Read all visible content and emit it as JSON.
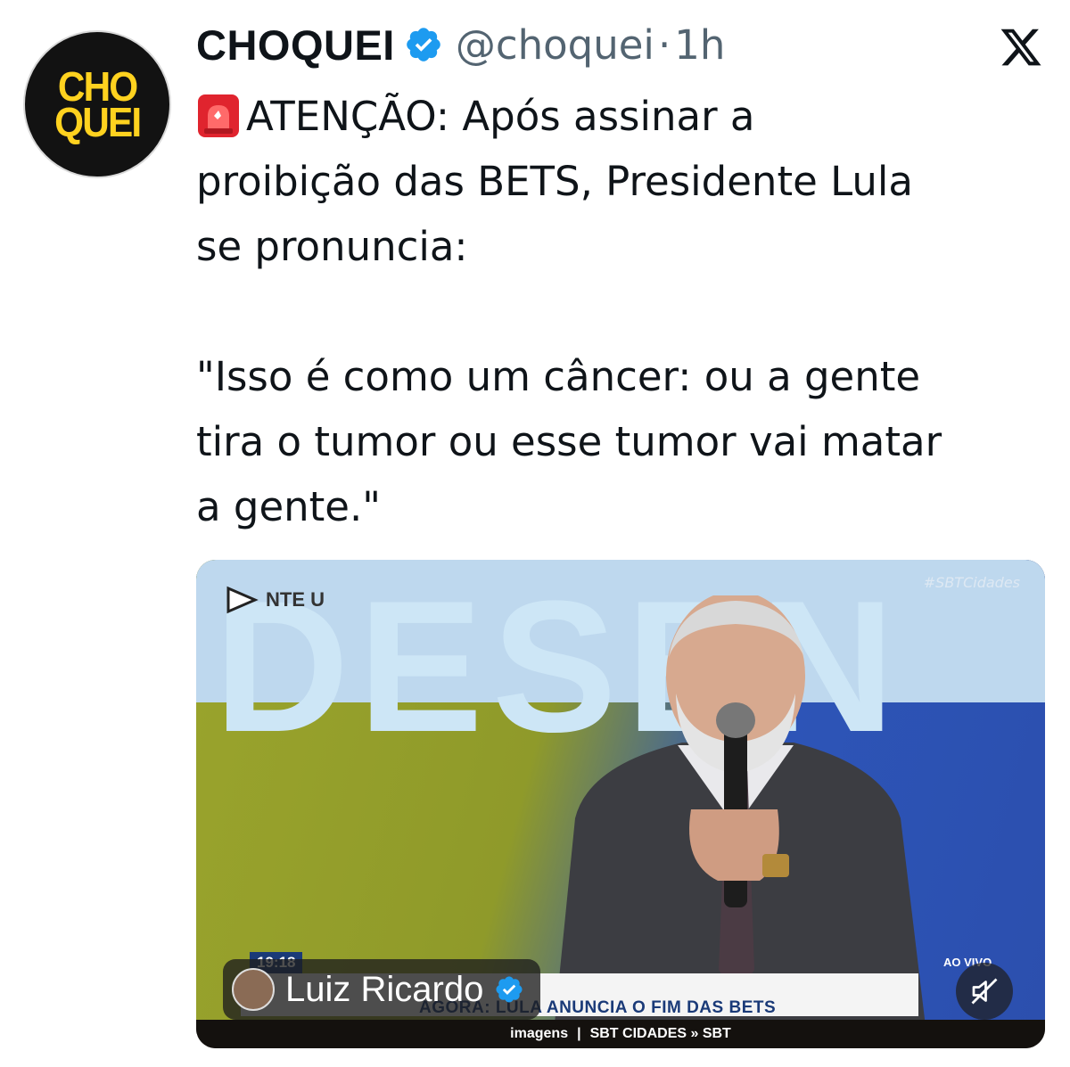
{
  "author": {
    "display_name": "CHOQUEI",
    "handle": "@choquei",
    "separator": "·",
    "time": "1h",
    "avatar_logo_lines": [
      "CHO",
      "QUEI"
    ]
  },
  "icons": {
    "verified": "verified-badge-icon",
    "platform": "x-logo-icon",
    "siren": "siren-emoji-icon",
    "mute": "muted-speaker-icon"
  },
  "tweet": {
    "line1": "ATENÇÃO: Após assinar a",
    "line2": "proibição das BETS, Presidente Lula",
    "line3": "se pronuncia:",
    "quote1": "\"Isso é como um câncer: ou a gente",
    "quote2": "tira o tumor ou esse tumor vai matar",
    "quote3": "a gente.\""
  },
  "media": {
    "background_word": "DESEN",
    "channel_logo_text": "NTE U",
    "hashtag": "#SBTCidades",
    "clock": "19:18",
    "ao_vivo": "AO VIVO",
    "ticker": "AGORA: LULA ANUNCIA O FIM DAS BETS",
    "credit_left": "imagens",
    "credit_sep": "|",
    "credit_right": "SBT CIDADES » SBT",
    "tagged_user": "Luiz Ricardo"
  },
  "colors": {
    "verified_blue": "#1d9bf0",
    "text": "#0f1419",
    "muted": "#536471",
    "logo_yellow": "#ffd21f"
  }
}
